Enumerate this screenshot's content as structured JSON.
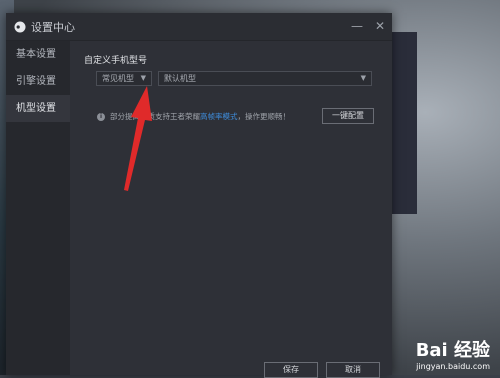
{
  "window": {
    "title": "设置中心",
    "minimize_glyph": "—",
    "close_glyph": "✕"
  },
  "sidebar": {
    "items": [
      {
        "label": "基本设置",
        "active": false
      },
      {
        "label": "引擎设置",
        "active": false
      },
      {
        "label": "机型设置",
        "active": true
      }
    ]
  },
  "main": {
    "section_label": "自定义手机型号",
    "brand_select": {
      "value": "常见机型",
      "icon": "chevron-down-icon"
    },
    "model_select": {
      "value": "默认机型",
      "icon": "chevron-down-icon"
    },
    "info": {
      "icon": "info-icon",
      "text_before": "部分提高画质支持王者荣耀",
      "link": "高帧率模式",
      "text_after": "，操作更顺畅！"
    },
    "one_click_button": "一键配置"
  },
  "footer": {
    "save_label": "保存",
    "cancel_label": "取消"
  },
  "annotation": {
    "arrow_color": "#e02a2a"
  },
  "watermark": {
    "brand": "Bai 经验",
    "url": "jingyan.baidu.com"
  },
  "colors": {
    "accent_link": "#3f8fe0",
    "dialog_bg": "#2e3037",
    "sidebar_bg": "#26282d"
  }
}
